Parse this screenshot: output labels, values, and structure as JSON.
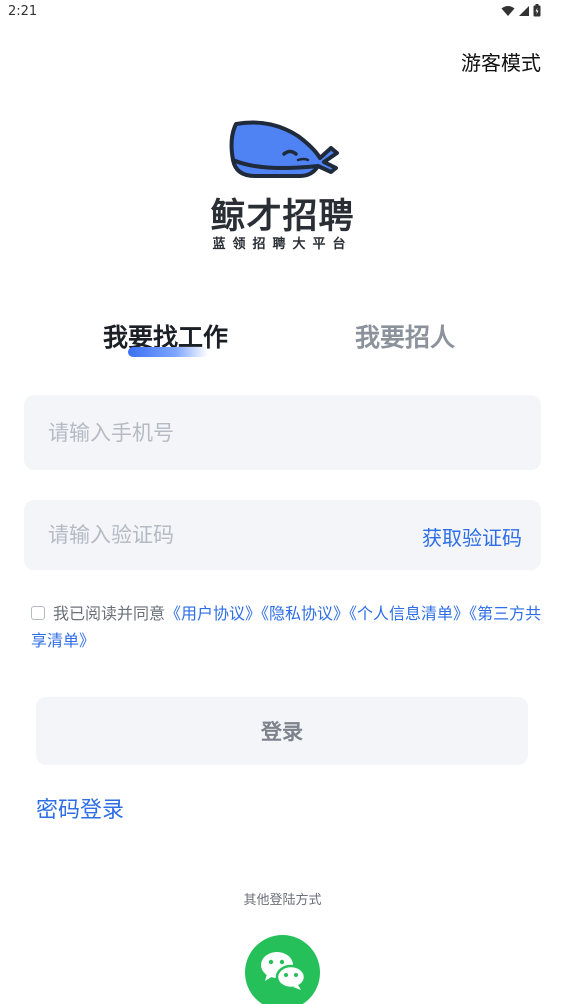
{
  "status_bar": {
    "time": "2:21"
  },
  "header": {
    "guest_mode": "游客模式"
  },
  "brand": {
    "name": "鲸才招聘",
    "slogan": "蓝领招聘大平台"
  },
  "tabs": [
    {
      "label": "我要找工作",
      "active": true
    },
    {
      "label": "我要招人",
      "active": false
    }
  ],
  "form": {
    "phone_placeholder": "请输入手机号",
    "code_placeholder": "请输入验证码",
    "get_code": "获取验证码"
  },
  "agreement": {
    "prefix": "我已阅读并同意",
    "links": [
      "《用户协议》",
      "《隐私协议》",
      "《个人信息清单》",
      "《第三方共享清单》"
    ]
  },
  "login_button": "登录",
  "password_login": "密码登录",
  "other_login": "其他登陆方式",
  "colors": {
    "accent": "#2d6ee6",
    "logo_blue": "#4f82f3",
    "input_bg": "#f3f5f9",
    "wechat_green": "#25c05a"
  }
}
